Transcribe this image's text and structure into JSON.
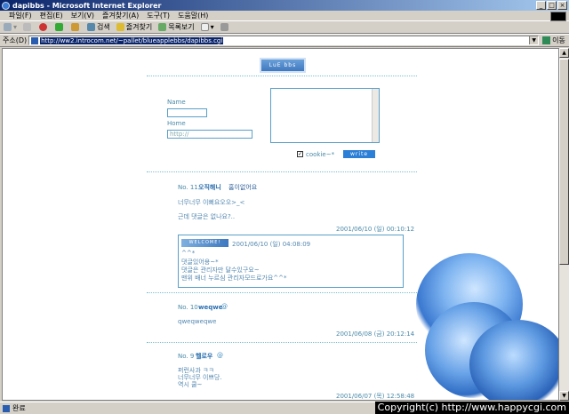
{
  "window": {
    "title": "dapibbs - Microsoft Internet Explorer"
  },
  "menu": [
    "파일(F)",
    "편집(E)",
    "보기(V)",
    "즐겨찾기(A)",
    "도구(T)",
    "도움말(H)"
  ],
  "toolbar": {
    "back": "뒤로",
    "search": "검색",
    "favorites": "즐겨찾기",
    "history": "목록보기"
  },
  "address": {
    "label": "주소(D)",
    "url": "http://ww2.introcom.net/~pallet/blueapplebbs/dapibbs.cgi",
    "go": "이동"
  },
  "form": {
    "banner": "LuE bbs",
    "name_label": "Name",
    "home_label": "Home",
    "home_value": "http://",
    "cookie_label": "cookie~*",
    "write_label": "write"
  },
  "posts": [
    {
      "no": "No. 11",
      "author": "오직해니",
      "subject": "홈이없어요",
      "body": [
        "너무너무 이뻐요오오>_<",
        "근데 댓글은 없나요?.."
      ],
      "date": "2001/06/10 (일) 00:10:12",
      "reply": {
        "badge": "WELCOME!",
        "date": "2001/06/10 (일) 04:08:09",
        "lines": [
          "^^*",
          "댓글있어용~*",
          "댓글은 관리자만 달수있구요~",
          "맨위 배너 누르심 관리자모드로가요^^*"
        ]
      }
    },
    {
      "no": "No. 10",
      "author": "weqwe",
      "subject": "",
      "body": [
        "qweqweqwe"
      ],
      "date": "2001/06/08 (금) 20:12:14"
    },
    {
      "no": "No. 9",
      "author": "헬로우",
      "subject": "",
      "body": [
        "퍼런사과 ㅋㅋ",
        "너무너무 이쁘당.",
        "역시 쿨~"
      ],
      "date": "2001/06/07 (목) 12:58:48"
    }
  ],
  "status": {
    "text": "완료"
  },
  "watermark": "Copyright(c) http://www.happycgi.com"
}
